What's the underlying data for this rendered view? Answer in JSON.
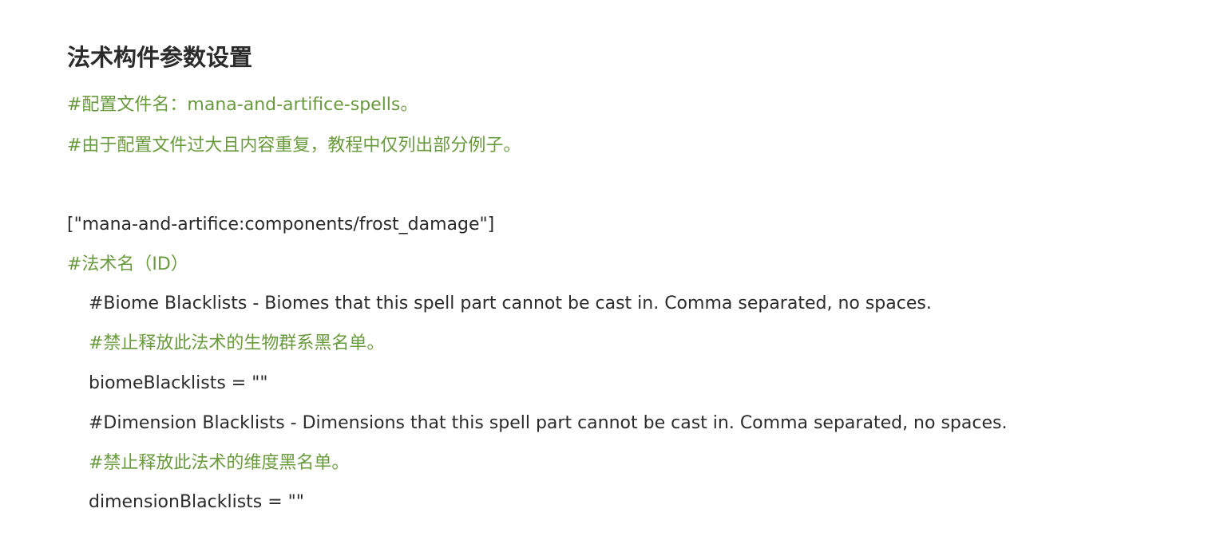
{
  "doc": {
    "title": "法术构件参数设置",
    "lines": [
      {
        "text": "#配置文件名：mana-and-artifice-spells。",
        "type": "comment"
      },
      {
        "text": "#由于配置文件过大且内容重复，教程中仅列出部分例子。",
        "type": "comment"
      },
      {
        "text": "[\"mana-and-artifice:components/frost_damage\"]",
        "type": "code"
      },
      {
        "text": "#法术名（ID）",
        "type": "comment"
      },
      {
        "text": "#Biome Blacklists - Biomes that this spell part cannot be cast in. Comma separated, no spaces.",
        "type": "code"
      },
      {
        "text": "#禁止释放此法术的生物群系黑名单。",
        "type": "comment"
      },
      {
        "text": "biomeBlacklists = \"\"",
        "type": "code"
      },
      {
        "text": "#Dimension Blacklists - Dimensions that this spell part cannot be cast in. Comma separated, no spaces.",
        "type": "code"
      },
      {
        "text": "#禁止释放此法术的维度黑名单。",
        "type": "comment"
      },
      {
        "text": "dimensionBlacklists = \"\"",
        "type": "code"
      }
    ]
  },
  "colors": {
    "comment": "#6a9a3e",
    "text": "#2b2b2b",
    "background": "#ffffff"
  }
}
